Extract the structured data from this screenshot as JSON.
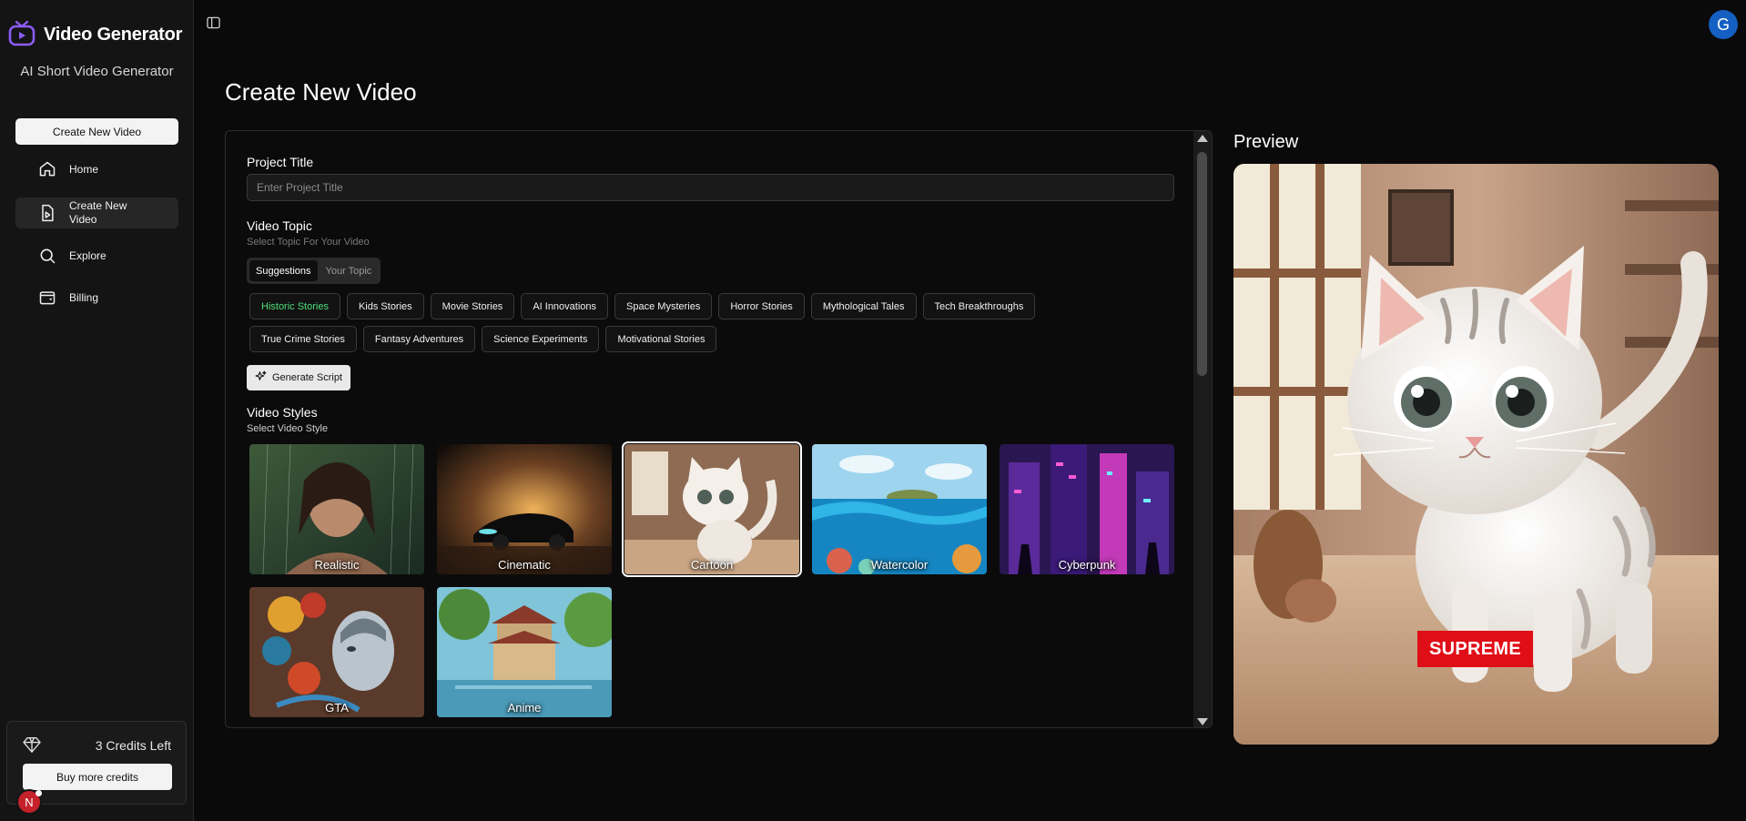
{
  "app": {
    "name": "Video Generator",
    "subtitle": "AI Short Video Generator",
    "create_button": "Create New Video"
  },
  "sidebar": {
    "items": [
      {
        "label": "Home",
        "icon": "home-icon"
      },
      {
        "label": "Create New Video",
        "icon": "file-video-icon",
        "active": true
      },
      {
        "label": "Explore",
        "icon": "search-icon"
      },
      {
        "label": "Billing",
        "icon": "wallet-icon"
      }
    ],
    "credits_text": "3 Credits Left",
    "buy_button": "Buy more credits",
    "user_initial": "N"
  },
  "header": {
    "user_initial": "G"
  },
  "page": {
    "title": "Create New Video"
  },
  "form": {
    "project_title_label": "Project Title",
    "project_title_placeholder": "Enter Project Title",
    "project_title_value": "",
    "video_topic_label": "Video Topic",
    "video_topic_hint": "Select Topic For Your Video",
    "topic_tabs": [
      "Suggestions",
      "Your Topic"
    ],
    "topics_row1": [
      "Historic Stories",
      "Kids Stories",
      "Movie Stories",
      "AI Innovations",
      "Space Mysteries",
      "Horror Stories",
      "Mythological Tales",
      "Tech Breakthroughs"
    ],
    "topics_row2": [
      "True Crime Stories",
      "Fantasy Adventures",
      "Science Experiments",
      "Motivational Stories"
    ],
    "selected_topic": "Historic Stories",
    "generate_button": "Generate Script",
    "styles_label": "Video Styles",
    "styles_hint": "Select Video Style",
    "styles": [
      "Realistic",
      "Cinematic",
      "Cartoon",
      "Watercolor",
      "Cyberpunk",
      "GTA",
      "Anime"
    ],
    "selected_style": "Cartoon"
  },
  "preview": {
    "title": "Preview",
    "caption": "SUPREME"
  },
  "colors": {
    "accent_purple": "#7c3aed",
    "selected_topic": "#4ee07a",
    "caption_red": "#e00e17",
    "avatar_blue": "#1460c2"
  }
}
